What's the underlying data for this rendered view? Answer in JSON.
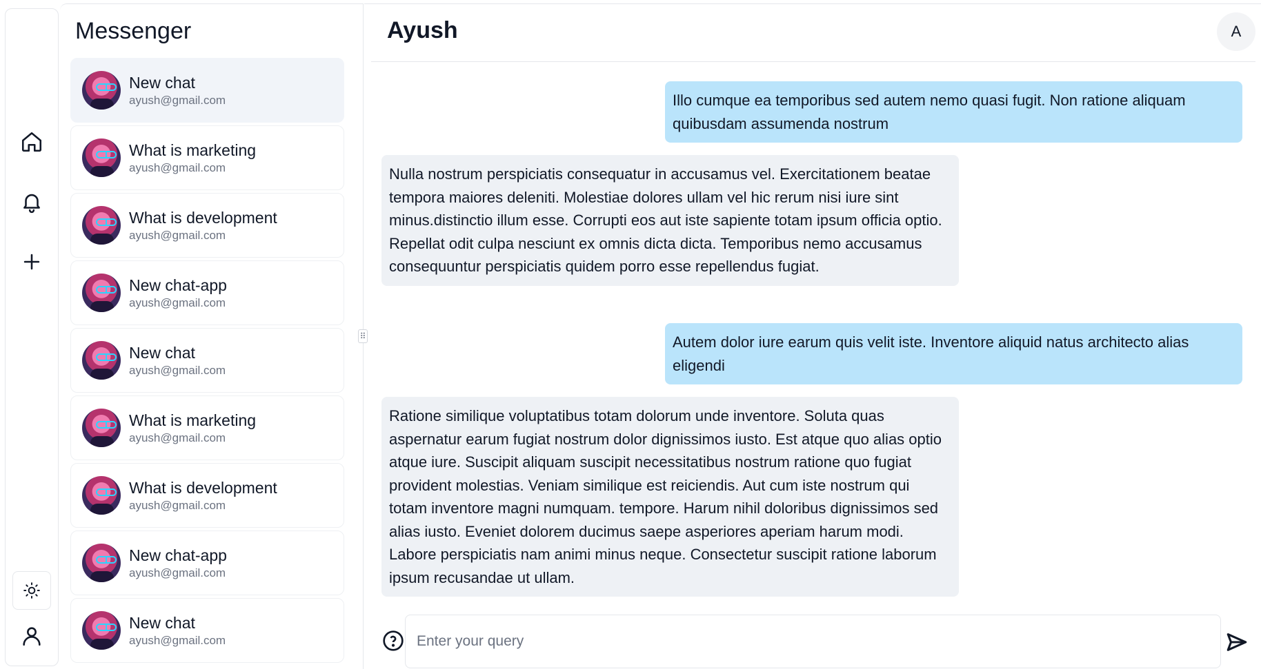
{
  "app": {
    "title": "Messenger"
  },
  "rail": {
    "items": [
      {
        "name": "home-icon"
      },
      {
        "name": "bell-icon"
      },
      {
        "name": "plus-icon"
      }
    ],
    "bottom": [
      {
        "name": "sun-icon"
      },
      {
        "name": "user-icon"
      }
    ]
  },
  "sidebar": {
    "title": "Messenger",
    "chats": [
      {
        "title": "New chat",
        "email": "ayush@gmail.com",
        "active": true
      },
      {
        "title": "What is marketing",
        "email": "ayush@gmail.com",
        "active": false
      },
      {
        "title": "What is development",
        "email": "ayush@gmail.com",
        "active": false
      },
      {
        "title": "New chat-app",
        "email": "ayush@gmail.com",
        "active": false
      },
      {
        "title": "New chat",
        "email": "ayush@gmail.com",
        "active": false
      },
      {
        "title": "What is marketing",
        "email": "ayush@gmail.com",
        "active": false
      },
      {
        "title": "What is development",
        "email": "ayush@gmail.com",
        "active": false
      },
      {
        "title": "New chat-app",
        "email": "ayush@gmail.com",
        "active": false
      },
      {
        "title": "New chat",
        "email": "ayush@gmail.com",
        "active": false
      }
    ]
  },
  "header": {
    "title": "Ayush",
    "avatar_initial": "A"
  },
  "messages": [
    {
      "role": "user",
      "text": "Illo cumque ea temporibus sed autem nemo quasi fugit. Non ratione aliquam quibusdam assumenda nostrum"
    },
    {
      "role": "bot",
      "text": "Nulla nostrum perspiciatis consequatur in accusamus vel. Exercitationem beatae tempora maiores deleniti. Molestiae dolores ullam vel hic rerum nisi iure sint minus.distinctio illum esse. Corrupti eos aut iste sapiente totam ipsum officia optio. Repellat odit culpa nesciunt ex omnis dicta dicta. Temporibus nemo accusamus consequuntur perspiciatis quidem porro esse repellendus fugiat."
    },
    {
      "role": "user",
      "text": "Autem dolor iure earum quis velit iste. Inventore aliquid natus architecto alias eligendi"
    },
    {
      "role": "bot",
      "text": "Ratione similique voluptatibus totam dolorum unde inventore. Soluta quas aspernatur earum fugiat nostrum dolor dignissimos iusto. Est atque quo alias optio atque iure. Suscipit aliquam suscipit necessitatibus nostrum ratione quo fugiat provident molestias. Veniam similique est reiciendis. Aut cum iste nostrum qui totam inventore magni numquam. tempore. Harum nihil doloribus dignissimos sed alias iusto. Eveniet dolorem ducimus saepe asperiores aperiam harum modi. Labore perspiciatis nam animi minus neque. Consectetur suscipit ratione laborum ipsum recusandae ut ullam."
    }
  ],
  "composer": {
    "placeholder": "Enter your query",
    "value": ""
  },
  "colors": {
    "user_bubble": "#bae4fb",
    "bot_bubble": "#eef1f5",
    "active_chat": "#f1f4f9",
    "border": "#e5e7eb"
  }
}
